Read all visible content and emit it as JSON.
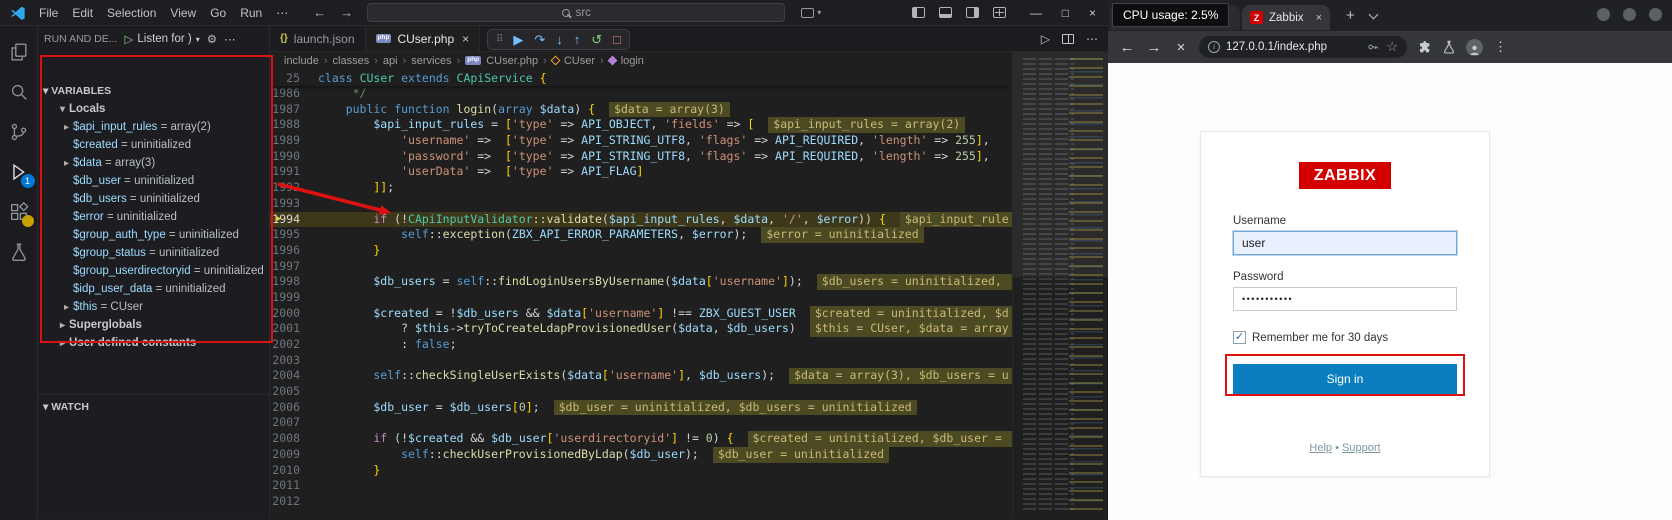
{
  "icons": {
    "grip": "⠿",
    "continue": "▶",
    "step_over": "↷",
    "step_into": "↓",
    "step_out": "↑",
    "restart": "↺",
    "stop": "□",
    "run": "▷",
    "more": "⋯",
    "gear": "⚙",
    "back": "←",
    "forward": "→",
    "stop_load": "×",
    "star": "☆",
    "menu_kebab": "⋮",
    "new_tab": "+",
    "close": "×",
    "chevron_down": "▾",
    "chevron_right": "▸",
    "json_braces": "{}",
    "php_badge": "php",
    "check": "✓",
    "bullet": "•",
    "breadcrumb_sep": "›"
  },
  "vscode": {
    "titlebar": {
      "menus": [
        "File",
        "Edit",
        "Selection",
        "View",
        "Go",
        "Run"
      ],
      "menu_overflow": "⋯",
      "search_text": "src",
      "window": {
        "minimize": "—",
        "maximize": "□",
        "close": "×"
      }
    },
    "activity": {
      "debug_badge": "1"
    },
    "sidebar": {
      "panel_title": "RUN AND DE...",
      "listen_label": "Listen for )",
      "variables_title": "VARIABLES",
      "watch_title": "WATCH",
      "equals": " = ",
      "scopes": {
        "locals": "Locals",
        "superglobals": "Superglobals",
        "constants": "User defined constants"
      },
      "locals": [
        {
          "name": "$api_input_rules",
          "value": "array(2)",
          "expandable": true
        },
        {
          "name": "$created",
          "value": "uninitialized",
          "expandable": false
        },
        {
          "name": "$data",
          "value": "array(3)",
          "expandable": true
        },
        {
          "name": "$db_user",
          "value": "uninitialized",
          "expandable": false
        },
        {
          "name": "$db_users",
          "value": "uninitialized",
          "expandable": false
        },
        {
          "name": "$error",
          "value": "uninitialized",
          "expandable": false
        },
        {
          "name": "$group_auth_type",
          "value": "uninitialized",
          "expandable": false
        },
        {
          "name": "$group_status",
          "value": "uninitialized",
          "expandable": false
        },
        {
          "name": "$group_userdirectoryid",
          "value": "uninitialized",
          "expandable": false
        },
        {
          "name": "$idp_user_data",
          "value": "uninitialized",
          "expandable": false
        },
        {
          "name": "$this",
          "value": "CUser",
          "expandable": true
        }
      ]
    },
    "editor": {
      "tabs": [
        {
          "label": "launch.json"
        },
        {
          "label": "CUser.php"
        }
      ],
      "breadcrumb": [
        "include",
        "classes",
        "api",
        "services",
        "CUser.php",
        "CUser",
        "login"
      ],
      "sticky": {
        "num": "25",
        "seg": [
          [
            "k",
            "class"
          ],
          [
            "p",
            " "
          ],
          [
            "t",
            "CUser"
          ],
          [
            "p",
            " "
          ],
          [
            "k",
            "extends"
          ],
          [
            "p",
            " "
          ],
          [
            "t",
            "CApiService"
          ],
          [
            "p",
            " "
          ],
          [
            "b",
            "{"
          ]
        ]
      },
      "current_line": "1994",
      "lines": [
        {
          "n": "1986",
          "seg": [
            [
              "cm",
              "     */"
            ]
          ]
        },
        {
          "n": "1987",
          "seg": [
            [
              "k",
              "    public"
            ],
            [
              "p",
              " "
            ],
            [
              "k",
              "function"
            ],
            [
              "p",
              " "
            ],
            [
              "f",
              "login"
            ],
            [
              "p",
              "("
            ],
            [
              "k",
              "array"
            ],
            [
              "p",
              " "
            ],
            [
              "v",
              "$data"
            ],
            [
              "p",
              ") "
            ],
            [
              "b",
              "{"
            ]
          ],
          "dbg": "$data = array(3)"
        },
        {
          "n": "1988",
          "seg": [
            [
              "v",
              "        $api_input_rules"
            ],
            [
              "p",
              " = "
            ],
            [
              "b",
              "["
            ],
            [
              "s",
              "'type'"
            ],
            [
              "p",
              " => "
            ],
            [
              "v",
              "API_OBJECT"
            ],
            [
              "p",
              ", "
            ],
            [
              "s",
              "'fields'"
            ],
            [
              "p",
              " => "
            ],
            [
              "b",
              "["
            ]
          ],
          "dbg": "$api_input_rules = array(2)"
        },
        {
          "n": "1989",
          "seg": [
            [
              "s",
              "            'username'"
            ],
            [
              "p",
              " =>  "
            ],
            [
              "b",
              "["
            ],
            [
              "s",
              "'type'"
            ],
            [
              "p",
              " => "
            ],
            [
              "v",
              "API_STRING_UTF8"
            ],
            [
              "p",
              ", "
            ],
            [
              "s",
              "'flags'"
            ],
            [
              "p",
              " => "
            ],
            [
              "v",
              "API_REQUIRED"
            ],
            [
              "p",
              ", "
            ],
            [
              "s",
              "'length'"
            ],
            [
              "p",
              " => "
            ],
            [
              "n",
              "255"
            ],
            [
              "b",
              "]"
            ],
            [
              "p",
              ","
            ]
          ]
        },
        {
          "n": "1990",
          "seg": [
            [
              "s",
              "            'password'"
            ],
            [
              "p",
              " =>  "
            ],
            [
              "b",
              "["
            ],
            [
              "s",
              "'type'"
            ],
            [
              "p",
              " => "
            ],
            [
              "v",
              "API_STRING_UTF8"
            ],
            [
              "p",
              ", "
            ],
            [
              "s",
              "'flags'"
            ],
            [
              "p",
              " => "
            ],
            [
              "v",
              "API_REQUIRED"
            ],
            [
              "p",
              ", "
            ],
            [
              "s",
              "'length'"
            ],
            [
              "p",
              " => "
            ],
            [
              "n",
              "255"
            ],
            [
              "b",
              "]"
            ],
            [
              "p",
              ","
            ]
          ]
        },
        {
          "n": "1991",
          "seg": [
            [
              "s",
              "            'userData'"
            ],
            [
              "p",
              " =>  "
            ],
            [
              "b",
              "["
            ],
            [
              "s",
              "'type'"
            ],
            [
              "p",
              " => "
            ],
            [
              "v",
              "API_FLAG"
            ],
            [
              "b",
              "]"
            ]
          ]
        },
        {
          "n": "1992",
          "seg": [
            [
              "b",
              "        ]]"
            ],
            [
              "p",
              ";"
            ]
          ]
        },
        {
          "n": "1993",
          "seg": []
        },
        {
          "n": "1994",
          "cur": true,
          "seg": [
            [
              "c",
              "        if"
            ],
            [
              "p",
              " (!"
            ],
            [
              "t",
              "CApiInputValidator"
            ],
            [
              "p",
              "::"
            ],
            [
              "f",
              "validate"
            ],
            [
              "p",
              "("
            ],
            [
              "v",
              "$api_input_rules"
            ],
            [
              "p",
              ", "
            ],
            [
              "v",
              "$data"
            ],
            [
              "p",
              ", "
            ],
            [
              "s",
              "'/'"
            ],
            [
              "p",
              ", "
            ],
            [
              "v",
              "$error"
            ],
            [
              "p",
              ")) "
            ],
            [
              "b",
              "{"
            ]
          ],
          "dbg": "$api_input_rule"
        },
        {
          "n": "1995",
          "seg": [
            [
              "k",
              "            self"
            ],
            [
              "p",
              "::"
            ],
            [
              "f",
              "exception"
            ],
            [
              "p",
              "("
            ],
            [
              "v",
              "ZBX_API_ERROR_PARAMETERS"
            ],
            [
              "p",
              ", "
            ],
            [
              "v",
              "$error"
            ],
            [
              "p",
              ");"
            ]
          ],
          "dbg": "$error = uninitialized"
        },
        {
          "n": "1996",
          "seg": [
            [
              "b",
              "        }"
            ]
          ]
        },
        {
          "n": "1997",
          "seg": []
        },
        {
          "n": "1998",
          "seg": [
            [
              "v",
              "        $db_users"
            ],
            [
              "p",
              " = "
            ],
            [
              "k",
              "self"
            ],
            [
              "p",
              "::"
            ],
            [
              "f",
              "findLoginUsersByUsername"
            ],
            [
              "p",
              "("
            ],
            [
              "v",
              "$data"
            ],
            [
              "b",
              "["
            ],
            [
              "s",
              "'username'"
            ],
            [
              "b",
              "]"
            ],
            [
              "p",
              ");"
            ]
          ],
          "dbg": "$db_users = uninitialized, "
        },
        {
          "n": "1999",
          "seg": []
        },
        {
          "n": "2000",
          "seg": [
            [
              "v",
              "        $created"
            ],
            [
              "p",
              " = !"
            ],
            [
              "v",
              "$db_users"
            ],
            [
              "p",
              " && "
            ],
            [
              "v",
              "$data"
            ],
            [
              "b",
              "["
            ],
            [
              "s",
              "'username'"
            ],
            [
              "b",
              "]"
            ],
            [
              "p",
              " !== "
            ],
            [
              "v",
              "ZBX_GUEST_USER"
            ]
          ],
          "dbg": "$created = uninitialized, $d"
        },
        {
          "n": "2001",
          "seg": [
            [
              "p",
              "            ? "
            ],
            [
              "v",
              "$this"
            ],
            [
              "p",
              "->"
            ],
            [
              "f",
              "tryToCreateLdapProvisionedUser"
            ],
            [
              "p",
              "("
            ],
            [
              "v",
              "$data"
            ],
            [
              "p",
              ", "
            ],
            [
              "v",
              "$db_users"
            ],
            [
              "p",
              ")"
            ]
          ],
          "dbg": "$this = CUser, $data = array"
        },
        {
          "n": "2002",
          "seg": [
            [
              "p",
              "            : "
            ],
            [
              "k",
              "false"
            ],
            [
              "p",
              ";"
            ]
          ]
        },
        {
          "n": "2003",
          "seg": []
        },
        {
          "n": "2004",
          "seg": [
            [
              "k",
              "        self"
            ],
            [
              "p",
              "::"
            ],
            [
              "f",
              "checkSingleUserExists"
            ],
            [
              "p",
              "("
            ],
            [
              "v",
              "$data"
            ],
            [
              "b",
              "["
            ],
            [
              "s",
              "'username'"
            ],
            [
              "b",
              "]"
            ],
            [
              "p",
              ", "
            ],
            [
              "v",
              "$db_users"
            ],
            [
              "p",
              ");"
            ]
          ],
          "dbg": "$data = array(3), $db_users = u"
        },
        {
          "n": "2005",
          "seg": []
        },
        {
          "n": "2006",
          "seg": [
            [
              "v",
              "        $db_user"
            ],
            [
              "p",
              " = "
            ],
            [
              "v",
              "$db_users"
            ],
            [
              "b",
              "["
            ],
            [
              "n",
              "0"
            ],
            [
              "b",
              "]"
            ],
            [
              "p",
              ";"
            ]
          ],
          "dbg": "$db_user = uninitialized, $db_users = uninitialized"
        },
        {
          "n": "2007",
          "seg": []
        },
        {
          "n": "2008",
          "seg": [
            [
              "c",
              "        if"
            ],
            [
              "p",
              " (!"
            ],
            [
              "v",
              "$created"
            ],
            [
              "p",
              " && "
            ],
            [
              "v",
              "$db_user"
            ],
            [
              "b",
              "["
            ],
            [
              "s",
              "'userdirectoryid'"
            ],
            [
              "b",
              "]"
            ],
            [
              "p",
              " != "
            ],
            [
              "n",
              "0"
            ],
            [
              "p",
              ") "
            ],
            [
              "b",
              "{"
            ]
          ],
          "dbg": "$created = uninitialized, $db_user = "
        },
        {
          "n": "2009",
          "seg": [
            [
              "k",
              "            self"
            ],
            [
              "p",
              "::"
            ],
            [
              "f",
              "checkUserProvisionedByLdap"
            ],
            [
              "p",
              "("
            ],
            [
              "v",
              "$db_user"
            ],
            [
              "p",
              ");"
            ]
          ],
          "dbg": "$db_user = uninitialized"
        },
        {
          "n": "2010",
          "seg": [
            [
              "b",
              "        }"
            ]
          ]
        },
        {
          "n": "2011",
          "seg": []
        },
        {
          "n": "2012",
          "seg": []
        }
      ]
    }
  },
  "browser": {
    "tooltip": "CPU usage: 2.5%",
    "tab": {
      "title": "Zabbix",
      "favicon": "Z"
    },
    "url": "127.0.0.1/index.php",
    "login": {
      "logo": "ZABBIX",
      "username_label": "Username",
      "username_value": "user",
      "password_label": "Password",
      "password_dots": "•••••••••••",
      "remember": "Remember me for 30 days",
      "signin": "Sign in",
      "help": "Help",
      "support": "Support"
    }
  }
}
